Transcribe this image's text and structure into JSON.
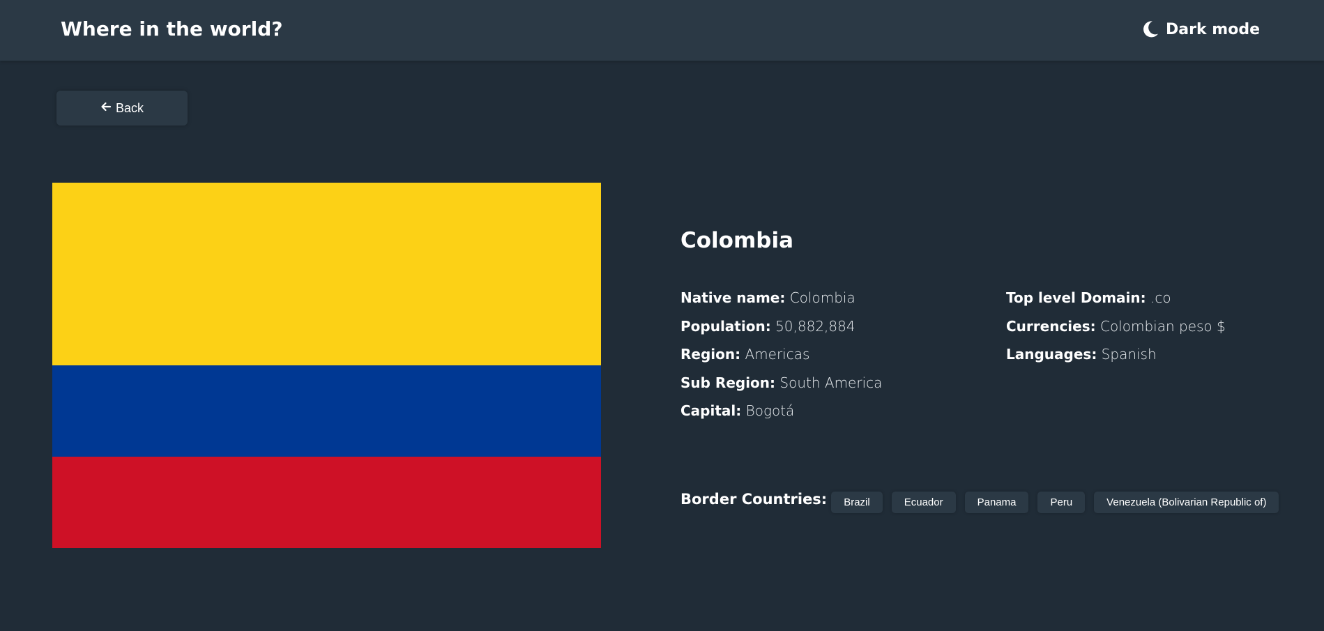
{
  "header": {
    "title": "Where in the world?",
    "theme_toggle_label": "Dark mode",
    "theme_icon": "moon-icon"
  },
  "back_button": {
    "label": "Back",
    "icon": "arrow-left-icon"
  },
  "country": {
    "name": "Colombia",
    "flag": {
      "stripes": [
        {
          "color": "#fcd116",
          "fraction": 0.5
        },
        {
          "color": "#003893",
          "fraction": 0.25
        },
        {
          "color": "#ce1126",
          "fraction": 0.25
        }
      ]
    },
    "details_left": [
      {
        "label": "Native name:",
        "value": "Colombia"
      },
      {
        "label": "Population:",
        "value": "50,882,884"
      },
      {
        "label": "Region:",
        "value": "Americas"
      },
      {
        "label": "Sub Region:",
        "value": "South America"
      },
      {
        "label": "Capital:",
        "value": "Bogotá"
      }
    ],
    "details_right": [
      {
        "label": "Top level Domain:",
        "value": ".co"
      },
      {
        "label": "Currencies:",
        "value": "Colombian peso $"
      },
      {
        "label": "Languages:",
        "value": "Spanish"
      }
    ],
    "border_countries_label": "Border Countries:",
    "border_countries": [
      "Brazil",
      "Ecuador",
      "Panama",
      "Peru",
      "Venezuela (Bolivarian Republic of)"
    ]
  },
  "colors": {
    "background": "#202c37",
    "elements": "#2b3945",
    "text": "#ffffff"
  }
}
